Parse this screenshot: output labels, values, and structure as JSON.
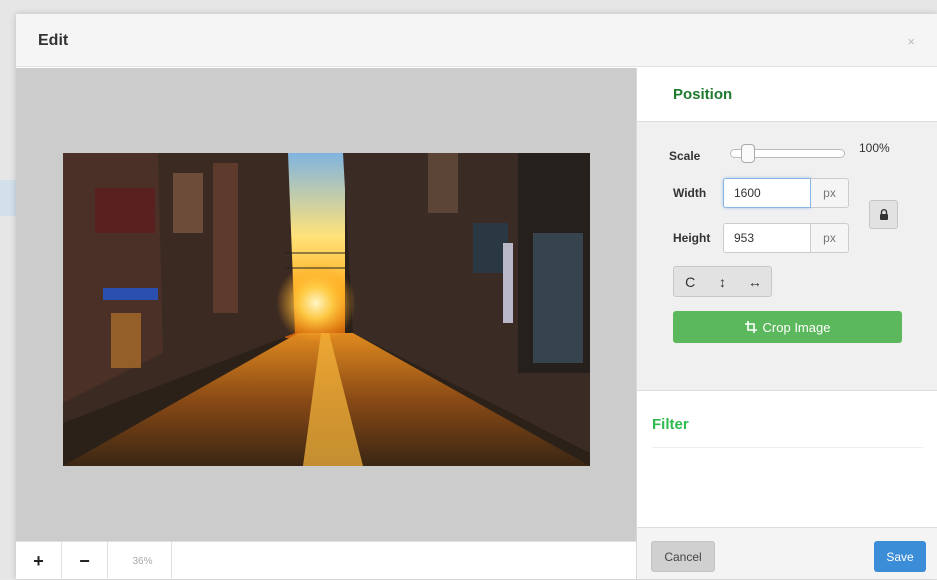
{
  "dialog": {
    "title": "Edit",
    "close_glyph": "×"
  },
  "canvas": {
    "image_alt": "street at sunset",
    "zoom": {
      "plus_label": "+",
      "minus_label": "−",
      "level": "36%"
    }
  },
  "position": {
    "title": "Position",
    "scale_label": "Scale",
    "scale_value": "100%",
    "width_label": "Width",
    "width_value": "1600",
    "height_label": "Height",
    "height_value": "953",
    "unit": "px",
    "tools": [
      {
        "icon": "rotate-icon",
        "glyph": "C"
      },
      {
        "icon": "flip-vertical-icon",
        "glyph": "↕"
      },
      {
        "icon": "flip-horizontal-icon",
        "glyph": "↔"
      }
    ],
    "crop_label": "Crop Image"
  },
  "filter": {
    "title": "Filter"
  },
  "footer": {
    "cancel_label": "Cancel",
    "save_label": "Save"
  },
  "colors": {
    "accent_green": "#5cb85c",
    "title_green": "#1f7a2e",
    "filter_green": "#2dbb4f",
    "save_blue": "#3c8dd8",
    "canvas_bg": "#cccccc"
  }
}
